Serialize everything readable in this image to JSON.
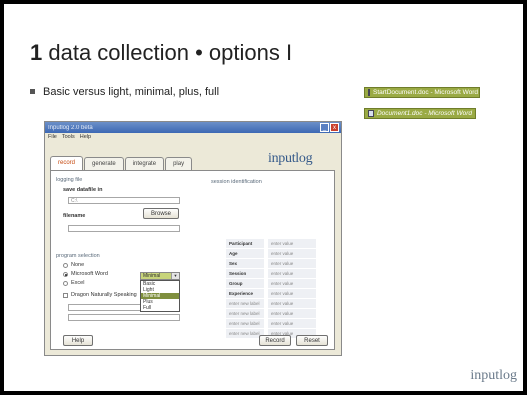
{
  "slide": {
    "title_num": "1",
    "title_text": " data collection • options I",
    "bullet": "Basic versus light, minimal, plus, full",
    "taskbar_buttons": [
      {
        "label": "StartDocument.doc - Microsoft Word",
        "icon": "word-doc-icon"
      },
      {
        "label": "Document1.doc - Microsoft Word",
        "icon": "word-doc-icon"
      }
    ],
    "footer_logo": "inputlog"
  },
  "window": {
    "title": "Inputlog 2.0 beta",
    "menu": [
      "File",
      "Tools",
      "Help"
    ],
    "tabs": [
      "record",
      "generate",
      "integrate",
      "play"
    ],
    "active_tab": "record",
    "logo": "inputlog",
    "logging_file": "logging file",
    "save_label": "save datafile in",
    "save_value": "C:\\",
    "filename_label": "filename",
    "browse": "Browse",
    "program_selection": "program selection",
    "programs": [
      "None",
      "Microsoft Word",
      "Excel"
    ],
    "selected_program": "Microsoft Word",
    "dragon": "Dragon Naturally Speaking",
    "select_value": "Minimal",
    "dropdown_options": [
      "Basic",
      "Light",
      "Minimal",
      "Plus",
      "Full"
    ],
    "dropdown_selected": "Minimal",
    "session_identification": "session identification",
    "session_rows": [
      {
        "k": "Participant",
        "v": "enter value"
      },
      {
        "k": "Age",
        "v": "enter value"
      },
      {
        "k": "Sex",
        "v": "enter value"
      },
      {
        "k": "Session",
        "v": "enter value"
      },
      {
        "k": "Group",
        "v": "enter value"
      },
      {
        "k": "Experience",
        "v": "enter value"
      },
      {
        "k": "enter new label",
        "v": "enter value",
        "dim": true
      },
      {
        "k": "enter new label",
        "v": "enter value",
        "dim": true
      },
      {
        "k": "enter new label",
        "v": "enter value",
        "dim": true
      },
      {
        "k": "enter new label",
        "v": "enter value",
        "dim": true
      }
    ],
    "help": "Help",
    "record": "Record",
    "reset": "Reset"
  }
}
